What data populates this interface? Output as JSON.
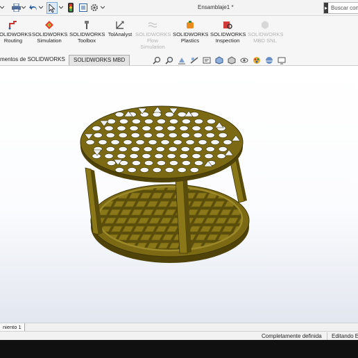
{
  "app": {
    "document_title": "Ensamblaje1 *",
    "search_placeholder": "Buscar con"
  },
  "ribbon": {
    "items": [
      {
        "line1": "SOLIDWORKS",
        "line2": "Routing",
        "enabled": true
      },
      {
        "line1": "SOLIDWORKS",
        "line2": "Simulation",
        "enabled": true
      },
      {
        "line1": "SOLIDWORKS",
        "line2": "Toolbox",
        "enabled": true
      },
      {
        "line1": "TolAnalyst",
        "line2": "",
        "enabled": true
      },
      {
        "line1": "SOLIDWORKS",
        "line2": "Flow",
        "line3": "Simulation",
        "enabled": false
      },
      {
        "line1": "SOLIDWORKS",
        "line2": "Plastics",
        "enabled": true
      },
      {
        "line1": "SOLIDWORKS",
        "line2": "Inspection",
        "enabled": true
      },
      {
        "line1": "SOLIDWORKS",
        "line2": "MBD SNL",
        "enabled": false
      }
    ]
  },
  "tabs": {
    "complementos": "mentos de SOLIDWORKS",
    "mbd": "SOLIDWORKS MBD"
  },
  "bottom": {
    "motion_tab": "niento 1"
  },
  "status": {
    "definition": "Completamente definida",
    "mode": "Editando E"
  },
  "colors": {
    "part_fill": "#7b6a13",
    "part_dark": "#4f430a",
    "part_light": "#9c8a2a"
  }
}
